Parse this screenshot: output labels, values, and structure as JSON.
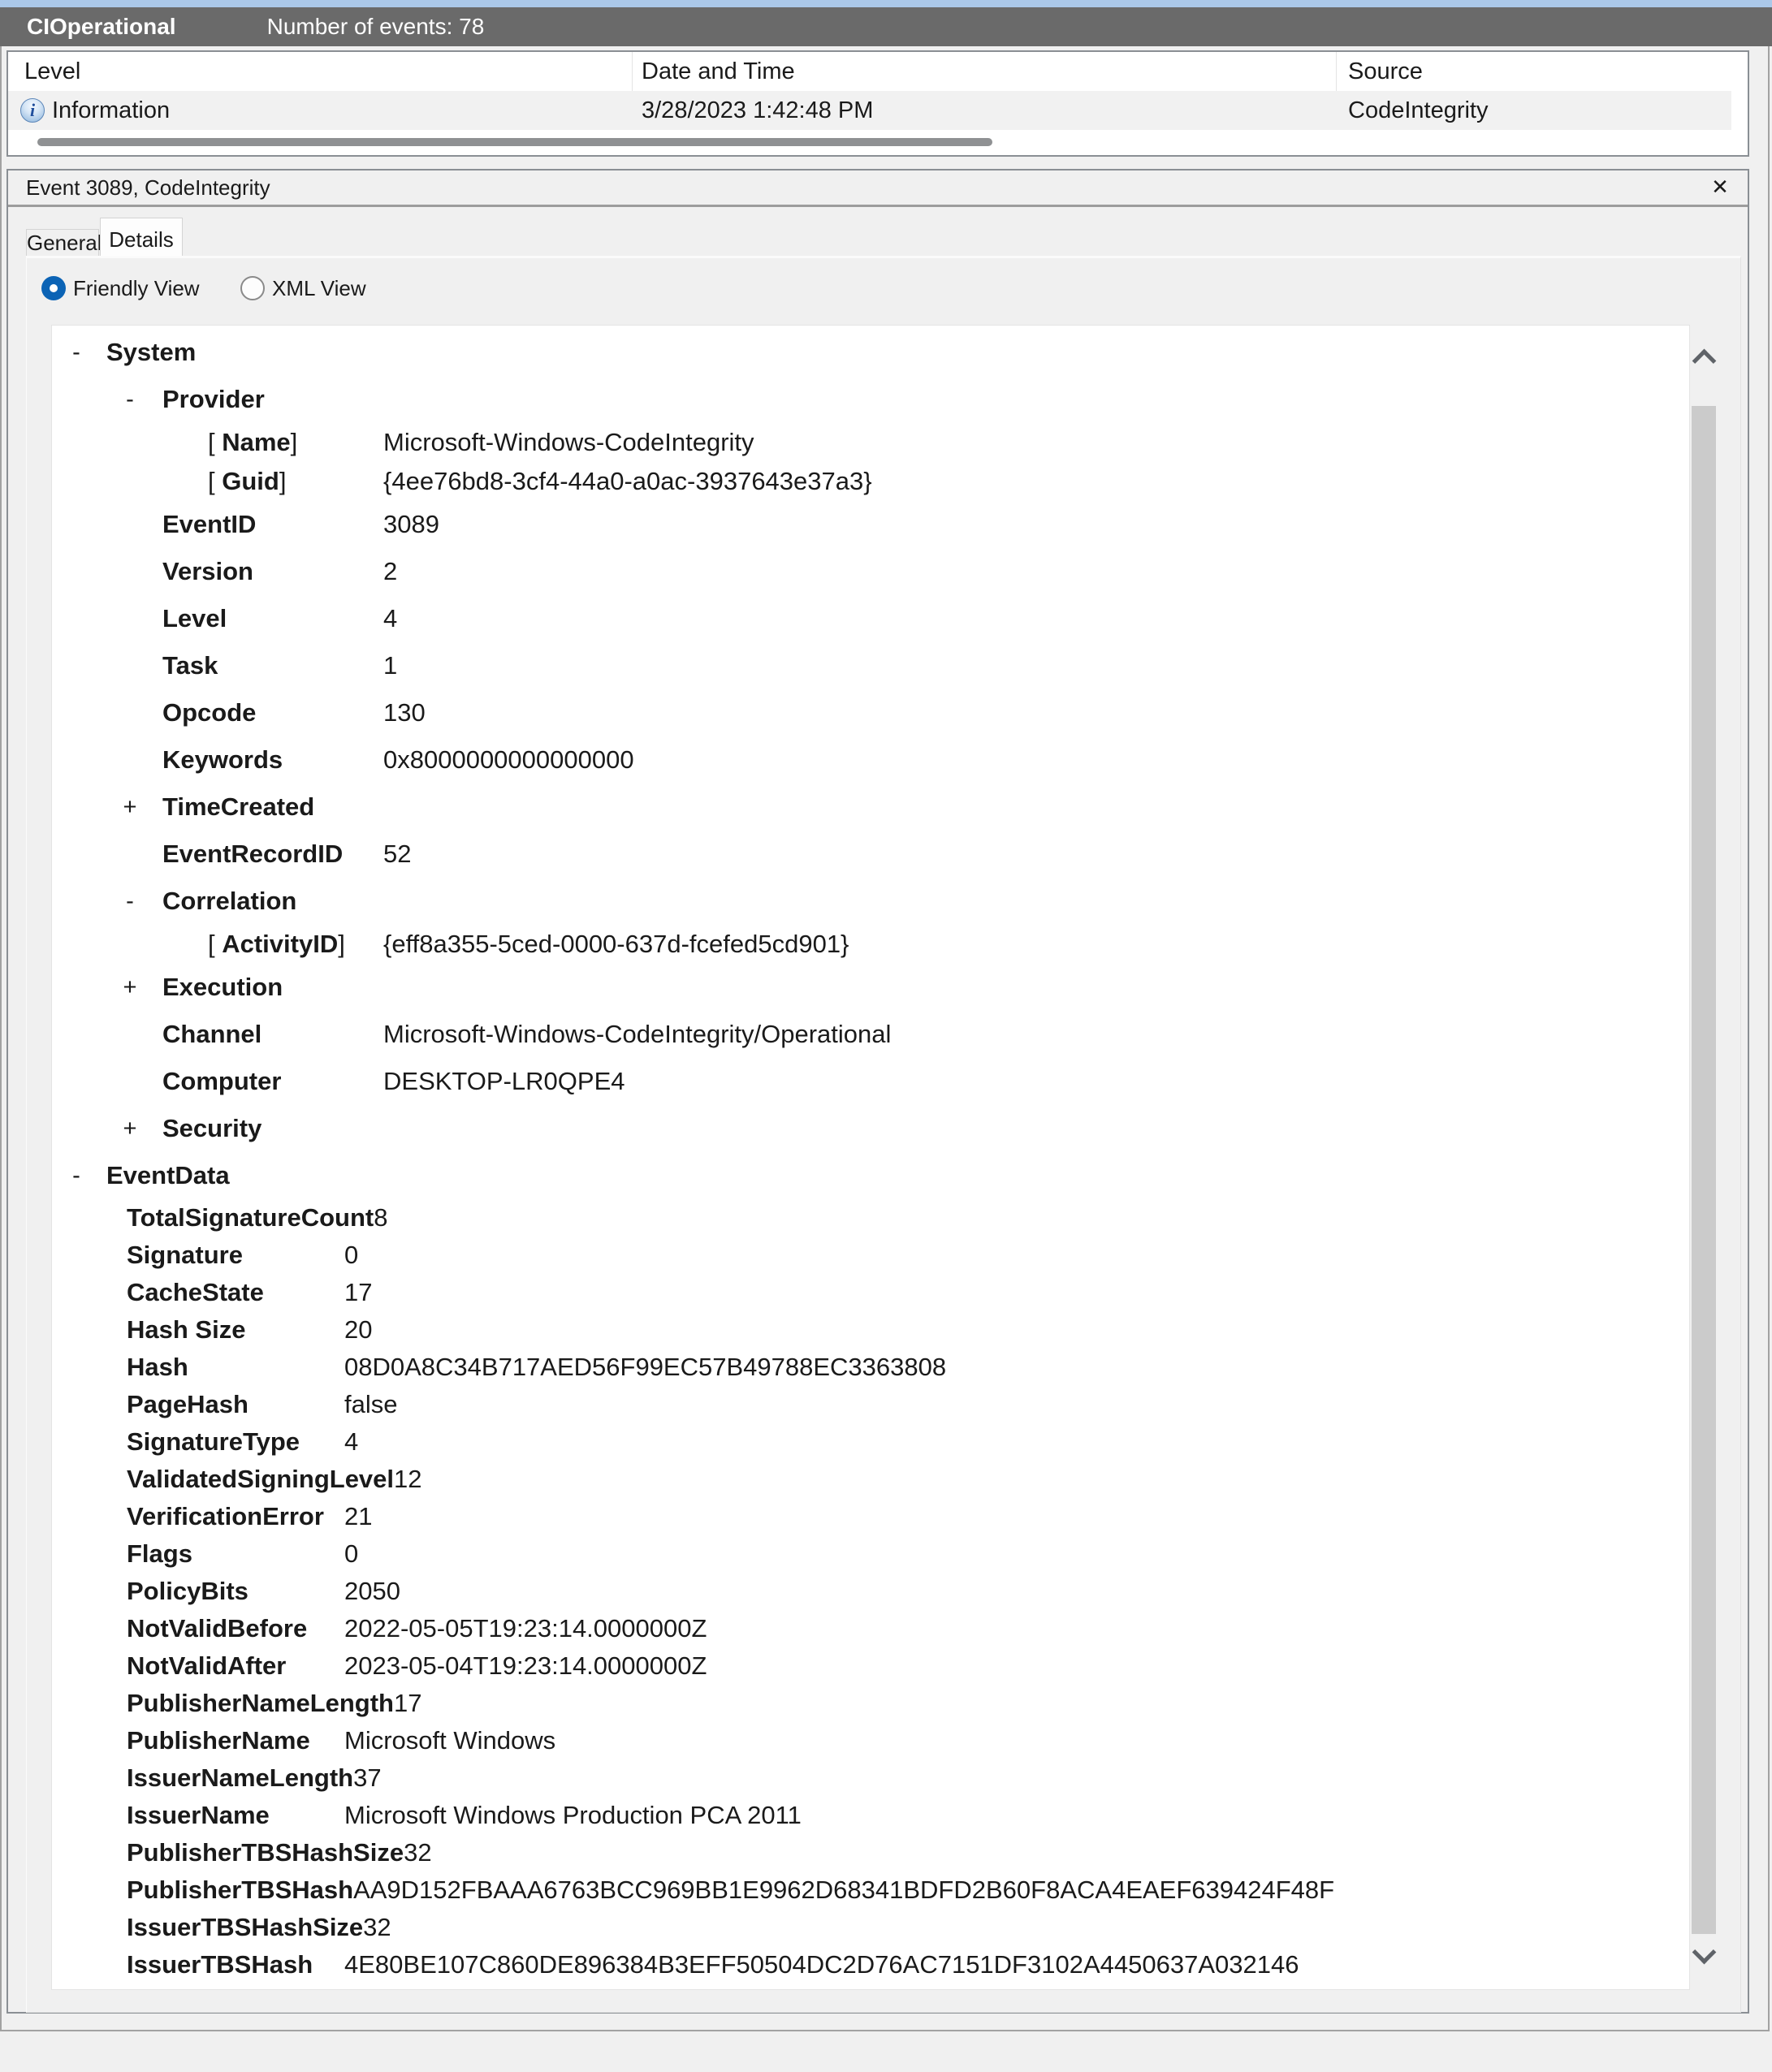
{
  "colors": {
    "accent_blue": "#0b63b5",
    "titlebar_gray": "#6a6a6a",
    "highlight_strip_blue": "#abc8e9",
    "info_blue": "#1f4e9c"
  },
  "icons": {
    "close": "✕",
    "info": "i"
  },
  "titlebar": {
    "log_name": "CIOperational",
    "events_count": "Number of events: 78"
  },
  "event_table": {
    "columns": [
      "Level",
      "Date and Time",
      "Source"
    ],
    "rows": [
      {
        "level": "Information",
        "date_time": "3/28/2023 1:42:48 PM",
        "source": "CodeIntegrity"
      }
    ]
  },
  "detail_panel": {
    "title": "Event 3089, CodeIntegrity",
    "tabs": [
      {
        "label": "General",
        "active": false
      },
      {
        "label": "Details",
        "active": true
      }
    ],
    "view_options": [
      {
        "label": "Friendly View",
        "selected": true
      },
      {
        "label": "XML View",
        "selected": false
      }
    ]
  },
  "tree": {
    "bracket_open": "[ ",
    "bracket_close": "]",
    "rows": [
      {
        "type": "sys",
        "indent": 0,
        "expander": "-",
        "label": "System",
        "value": ""
      },
      {
        "type": "sys",
        "indent": 1,
        "expander": "-",
        "label": "Provider",
        "value": ""
      },
      {
        "type": "bracket",
        "indent": 2,
        "expander": "",
        "label": "Name",
        "value": "Microsoft-Windows-CodeIntegrity"
      },
      {
        "type": "bracket",
        "indent": 2,
        "expander": "",
        "label": "Guid",
        "value": "{4ee76bd8-3cf4-44a0-a0ac-3937643e37a3}"
      },
      {
        "type": "sys",
        "indent": 1,
        "expander": "",
        "label": "EventID",
        "value": "3089"
      },
      {
        "type": "sys",
        "indent": 1,
        "expander": "",
        "label": "Version",
        "value": "2"
      },
      {
        "type": "sys",
        "indent": 1,
        "expander": "",
        "label": "Level",
        "value": "4"
      },
      {
        "type": "sys",
        "indent": 1,
        "expander": "",
        "label": "Task",
        "value": "1"
      },
      {
        "type": "sys",
        "indent": 1,
        "expander": "",
        "label": "Opcode",
        "value": "130"
      },
      {
        "type": "sys",
        "indent": 1,
        "expander": "",
        "label": "Keywords",
        "value": "0x8000000000000000"
      },
      {
        "type": "sys",
        "indent": 1,
        "expander": "+",
        "label": "TimeCreated",
        "value": ""
      },
      {
        "type": "sys",
        "indent": 1,
        "expander": "",
        "label": "EventRecordID",
        "value": "52"
      },
      {
        "type": "sys",
        "indent": 1,
        "expander": "-",
        "label": "Correlation",
        "value": ""
      },
      {
        "type": "bracket",
        "indent": 2,
        "expander": "",
        "label": "ActivityID",
        "value": "{eff8a355-5ced-0000-637d-fcefed5cd901}"
      },
      {
        "type": "sys",
        "indent": 1,
        "expander": "+",
        "label": "Execution",
        "value": ""
      },
      {
        "type": "sys",
        "indent": 1,
        "expander": "",
        "label": "Channel",
        "value": "Microsoft-Windows-CodeIntegrity/Operational"
      },
      {
        "type": "sys",
        "indent": 1,
        "expander": "",
        "label": "Computer",
        "value": "DESKTOP-LR0QPE4"
      },
      {
        "type": "sys",
        "indent": 1,
        "expander": "+",
        "label": "Security",
        "value": ""
      },
      {
        "type": "sys",
        "indent": 0,
        "expander": "-",
        "label": "EventData",
        "value": ""
      },
      {
        "type": "data",
        "indent": 1,
        "expander": "",
        "label": "TotalSignatureCount",
        "value": "8"
      },
      {
        "type": "data",
        "indent": 1,
        "expander": "",
        "label": "Signature",
        "value": "0"
      },
      {
        "type": "data",
        "indent": 1,
        "expander": "",
        "label": "CacheState",
        "value": "17"
      },
      {
        "type": "data",
        "indent": 1,
        "expander": "",
        "label": "Hash Size",
        "value": "20"
      },
      {
        "type": "data",
        "indent": 1,
        "expander": "",
        "label": "Hash",
        "value": "08D0A8C34B717AED56F99EC57B49788EC3363808"
      },
      {
        "type": "data",
        "indent": 1,
        "expander": "",
        "label": "PageHash",
        "value": "false"
      },
      {
        "type": "data",
        "indent": 1,
        "expander": "",
        "label": "SignatureType",
        "value": "4"
      },
      {
        "type": "data",
        "indent": 1,
        "expander": "",
        "label": "ValidatedSigningLevel",
        "value": "12"
      },
      {
        "type": "data",
        "indent": 1,
        "expander": "",
        "label": "VerificationError",
        "value": "21"
      },
      {
        "type": "data",
        "indent": 1,
        "expander": "",
        "label": "Flags",
        "value": "0"
      },
      {
        "type": "data",
        "indent": 1,
        "expander": "",
        "label": "PolicyBits",
        "value": "2050"
      },
      {
        "type": "data",
        "indent": 1,
        "expander": "",
        "label": "NotValidBefore",
        "value": "2022-05-05T19:23:14.0000000Z"
      },
      {
        "type": "data",
        "indent": 1,
        "expander": "",
        "label": "NotValidAfter",
        "value": "2023-05-04T19:23:14.0000000Z"
      },
      {
        "type": "data",
        "indent": 1,
        "expander": "",
        "label": "PublisherNameLength",
        "value": "17"
      },
      {
        "type": "data",
        "indent": 1,
        "expander": "",
        "label": "PublisherName",
        "value": "Microsoft Windows"
      },
      {
        "type": "data",
        "indent": 1,
        "expander": "",
        "label": "IssuerNameLength",
        "value": "37"
      },
      {
        "type": "data",
        "indent": 1,
        "expander": "",
        "label": "IssuerName",
        "value": "Microsoft Windows Production PCA 2011"
      },
      {
        "type": "data",
        "indent": 1,
        "expander": "",
        "label": "PublisherTBSHashSize",
        "value": "32"
      },
      {
        "type": "data",
        "indent": 1,
        "expander": "",
        "label": "PublisherTBSHash",
        "value": "AA9D152FBAAA6763BCC969BB1E9962D68341BDFD2B60F8ACA4EAEF639424F48F"
      },
      {
        "type": "data",
        "indent": 1,
        "expander": "",
        "label": "IssuerTBSHashSize",
        "value": "32"
      },
      {
        "type": "data",
        "indent": 1,
        "expander": "",
        "label": "IssuerTBSHash",
        "value": "4E80BE107C860DE896384B3EFF50504DC2D76AC7151DF3102A4450637A032146"
      }
    ]
  }
}
